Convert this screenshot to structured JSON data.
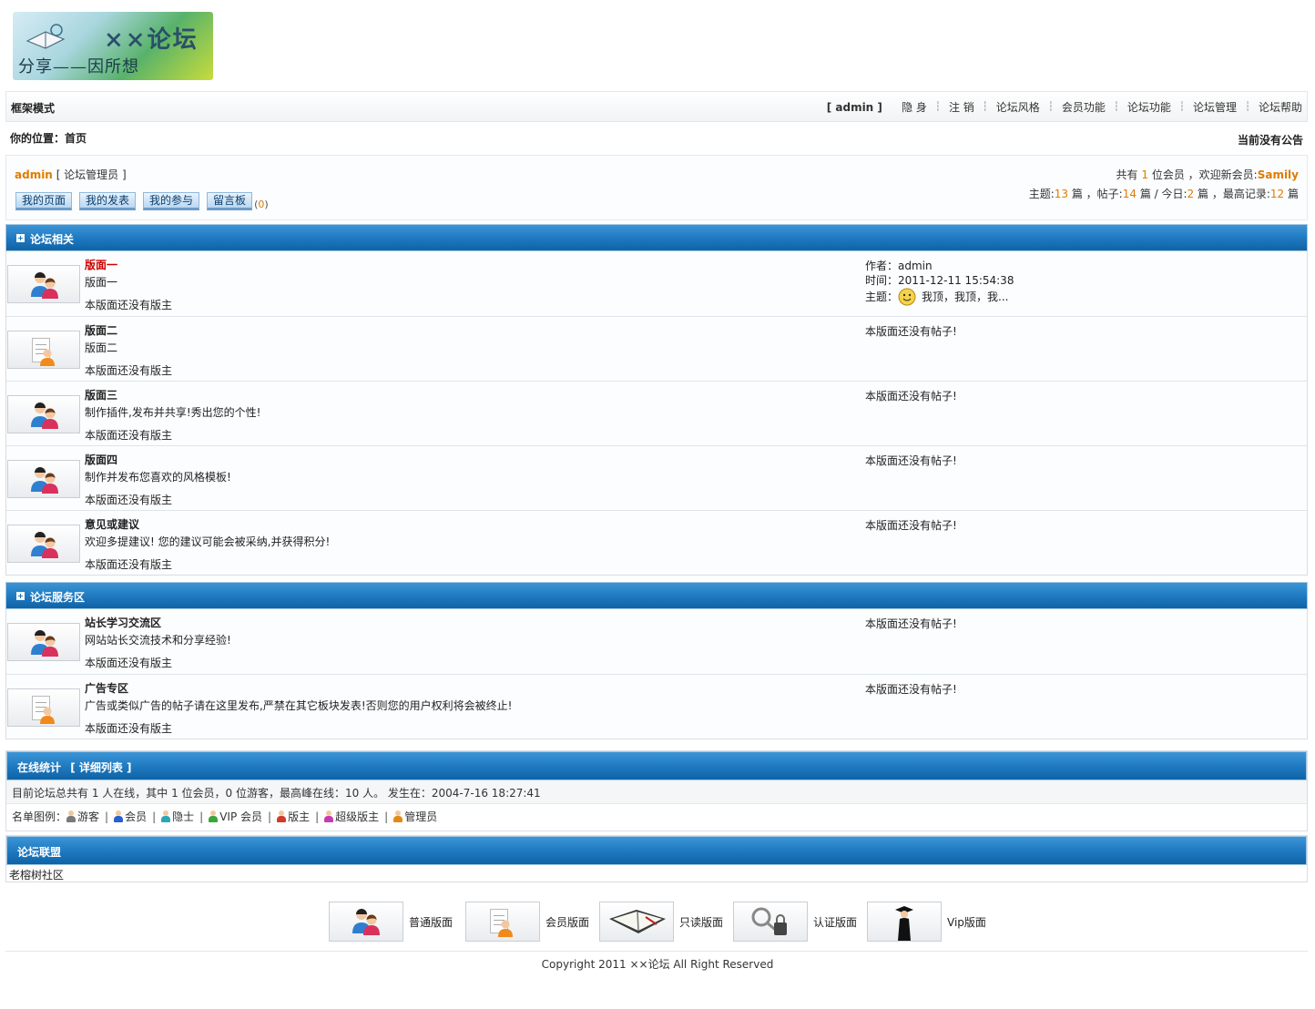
{
  "logo": {
    "title": "××论坛",
    "slogan": "分享——因所想"
  },
  "topnav": {
    "mode_label": "框架模式",
    "user_link": "[ admin ]",
    "links": [
      "隐 身",
      "注 销",
      "论坛风格",
      "会员功能",
      "论坛功能",
      "论坛管理",
      "论坛帮助"
    ]
  },
  "location": {
    "label": "你的位置：首页",
    "notice": "当前没有公告"
  },
  "userpanel": {
    "username": "admin",
    "role": "[ 论坛管理员 ]",
    "buttons": [
      "我的页面",
      "我的发表",
      "我的参与",
      "留言板"
    ],
    "message_count_prefix": "(",
    "message_count": "0",
    "message_count_suffix": ")",
    "members_prefix": "共有",
    "member_count": "1",
    "members_mid": "位会员 ，欢迎新会员:",
    "newest_member": "Samily",
    "topics_label": "主题:",
    "topics": "13",
    "posts_label": "篇 ，帖子:",
    "posts": "14",
    "today_label": "篇 / 今日:",
    "today": "2",
    "record_label": "篇 ，最高记录:",
    "record": "12",
    "record_suffix": "篇"
  },
  "sections": [
    {
      "title": "论坛相关",
      "forums": [
        {
          "name": "版面一",
          "desc": "版面一",
          "moderator": "本版面还没有版主",
          "icon": "users-icon",
          "author": "作者：admin",
          "time": "时间：2011-12-11 15:54:38",
          "topic_label": "主题：",
          "topic": "我顶，我顶，我..."
        },
        {
          "name": "版面二",
          "desc": "版面二",
          "moderator": "本版面还没有版主",
          "icon": "member-doc-icon",
          "no_posts": "本版面还没有帖子!"
        },
        {
          "name": "版面三",
          "desc": "制作插件,发布并共享!秀出您的个性!",
          "moderator": "本版面还没有版主",
          "icon": "users-icon",
          "no_posts": "本版面还没有帖子!"
        },
        {
          "name": "版面四",
          "desc": "制作并发布您喜欢的风格模板!",
          "moderator": "本版面还没有版主",
          "icon": "users-icon",
          "no_posts": "本版面还没有帖子!"
        },
        {
          "name": "意见或建议",
          "desc": "欢迎多提建议! 您的建议可能会被采纳,并获得积分!",
          "moderator": "本版面还没有版主",
          "icon": "users-icon",
          "no_posts": "本版面还没有帖子!"
        }
      ]
    },
    {
      "title": "论坛服务区",
      "forums": [
        {
          "name": "站长学习交流区",
          "desc": "网站站长交流技术和分享经验!",
          "moderator": "本版面还没有版主",
          "icon": "users-icon",
          "no_posts": "本版面还没有帖子!"
        },
        {
          "name": "广告专区",
          "desc": "广告或类似广告的帖子请在这里发布,严禁在其它板块发表!否则您的用户权利将会被终止!",
          "moderator": "本版面还没有版主",
          "icon": "member-doc-icon",
          "no_posts": "本版面还没有帖子!"
        }
      ]
    }
  ],
  "online": {
    "title": "在线统计",
    "detail_link": "[ 详细列表 ]",
    "summary": "目前论坛总共有 1 人在线，其中 1 位会员，0 位游客，最高峰在线：10 人。 发生在：2004-7-16 18:27:41",
    "legend_label": "名单图例：",
    "legend": [
      {
        "label": "游客",
        "color": "#7a7a7a"
      },
      {
        "label": "会员",
        "color": "#2a5fcf"
      },
      {
        "label": "隐士",
        "color": "#2aa6b5"
      },
      {
        "label": "VIP 会员",
        "color": "#3aa63a"
      },
      {
        "label": "版主",
        "color": "#d23a2a"
      },
      {
        "label": "超级版主",
        "color": "#c83ab0"
      },
      {
        "label": "管理员",
        "color": "#e08a1a"
      }
    ]
  },
  "union": {
    "title": "论坛联盟",
    "item": "老榕树社区"
  },
  "board_legend": [
    {
      "label": "普通版面",
      "icon": "users-icon"
    },
    {
      "label": "会员版面",
      "icon": "member-doc-icon"
    },
    {
      "label": "只读版面",
      "icon": "notebook-icon"
    },
    {
      "label": "认证版面",
      "icon": "key-lock-icon"
    },
    {
      "label": "Vip版面",
      "icon": "graduate-icon"
    }
  ],
  "copyright": "Copyright 2011 ××论坛 All Right Reserved",
  "colors": {
    "accent_orange": "#e07b00",
    "header_blue": "#1e78bf",
    "link_blue": "#0a5fa8",
    "forum_red": "#cc0000"
  }
}
